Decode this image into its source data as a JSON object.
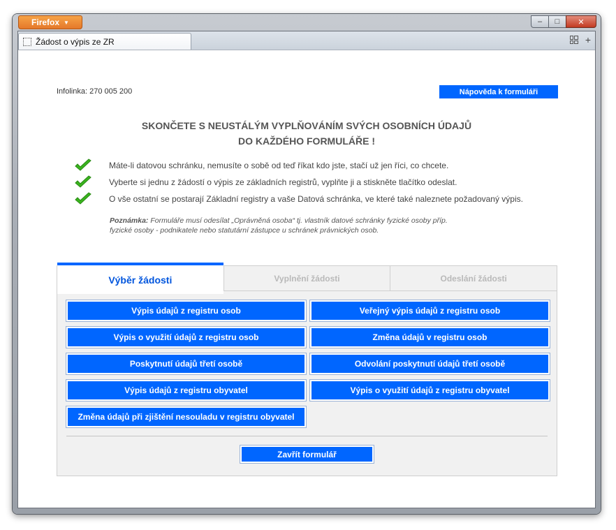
{
  "browser": {
    "menu_label": "Firefox",
    "tab_title": "Žádost o výpis ze ZR",
    "controls": {
      "minimize": "‒",
      "maximize": "□",
      "close": "✕"
    }
  },
  "header": {
    "infoline": "Infolinka: 270 005 200",
    "help_button": "Nápověda k formuláři"
  },
  "headline": {
    "line1": "SKONČETE S NEUSTÁLÝM VYPLŇOVÁNÍM SVÝCH OSOBNÍCH ÚDAJŮ",
    "line2": "DO KAŽDÉHO FORMULÁŘE !"
  },
  "checklist": [
    "Máte-li datovou schránku, nemusíte o sobě od teď říkat kdo jste, stačí už jen říci, co chcete.",
    "Vyberte si jednu z žádostí o výpis ze základních registrů, vyplňte ji a stiskněte tlačítko odeslat.",
    "O vše ostatní se postarají Základní registry a vaše Datová schránka, ve které také naleznete požadovaný výpis."
  ],
  "note": {
    "label": "Poznámka:",
    "line1": " Formuláře musí odesílat „Oprávněná osoba“ tj. vlastník datové schránky fyzické osoby příp.",
    "line2": "fyzické osoby - podnikatele nebo statutární zástupce u schránek právnických osob."
  },
  "wizard_tabs": [
    {
      "label": "Výběr žádosti",
      "active": true
    },
    {
      "label": "Vyplnění žádosti",
      "active": false
    },
    {
      "label": "Odeslání žádosti",
      "active": false
    }
  ],
  "request_buttons": [
    "Výpis údajů z registru osob",
    "Veřejný výpis údajů z registru osob",
    "Výpis o využití údajů z registru osob",
    "Změna údajů v registru osob",
    "Poskytnutí údajů třetí osobě",
    "Odvolání poskytnutí údajů třetí osobě",
    "Výpis údajů z registru obyvatel",
    "Výpis o využití údajů z registru obyvatel",
    "Změna údajů při zjištění nesouladu v registru obyvatel"
  ],
  "close_button": "Zavřít formulář",
  "colors": {
    "accent": "#0066ff",
    "check": "#3ab41e",
    "firefox": "#e5782a"
  }
}
